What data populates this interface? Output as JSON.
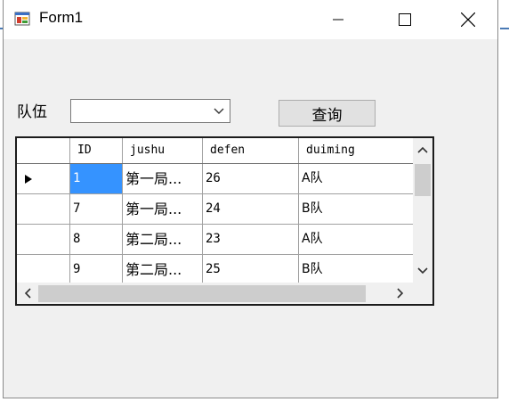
{
  "window": {
    "title": "Form1"
  },
  "form": {
    "team_label": "队伍",
    "team_combo_value": "",
    "query_button": "查询"
  },
  "grid": {
    "columns": [
      "ID",
      "jushu",
      "defen",
      "duiming"
    ],
    "rows": [
      {
        "id": "1",
        "jushu": "第一局...",
        "defen": "26",
        "duiming": "A队",
        "selected": true
      },
      {
        "id": "7",
        "jushu": "第一局...",
        "defen": "24",
        "duiming": "B队"
      },
      {
        "id": "8",
        "jushu": "第二局...",
        "defen": "23",
        "duiming": "A队"
      },
      {
        "id": "9",
        "jushu": "第二局...",
        "defen": "25",
        "duiming": "B队"
      }
    ]
  },
  "colors": {
    "selection": "#3593ff",
    "window_bg": "#f0f0f0",
    "accent": "#4a7ab5"
  },
  "icons": [
    "app-icon",
    "minimize-icon",
    "maximize-icon",
    "close-icon",
    "chevron-down-icon",
    "row-pointer-icon",
    "scroll-up-icon",
    "scroll-down-icon",
    "scroll-left-icon",
    "scroll-right-icon"
  ]
}
